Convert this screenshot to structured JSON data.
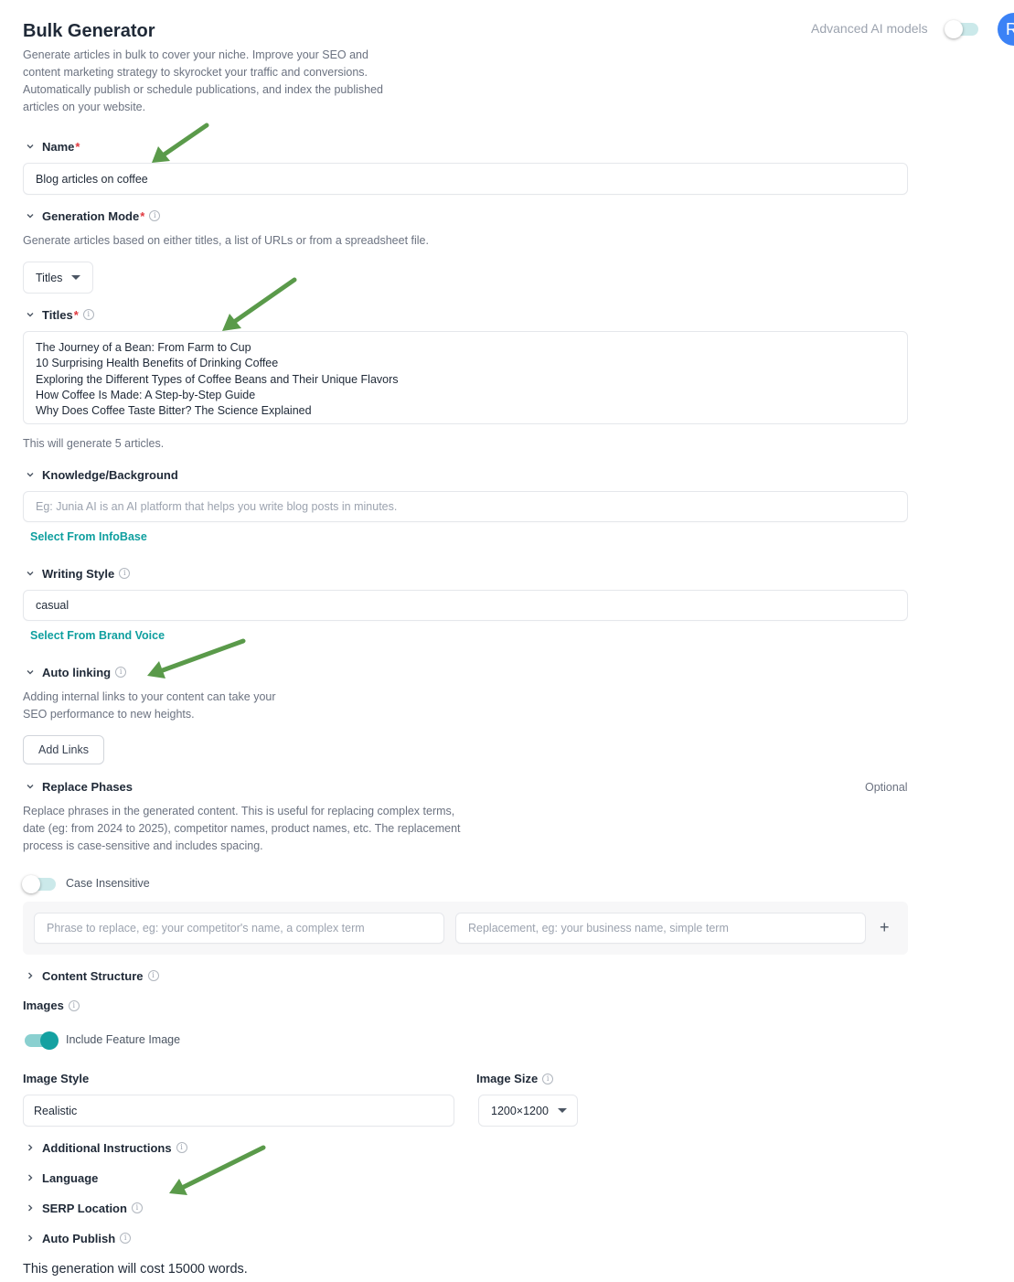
{
  "header": {
    "title": "Bulk Generator",
    "description": "Generate articles in bulk to cover your niche. Improve your SEO and content marketing strategy to skyrocket your traffic and conversions. Automatically publish or schedule publications, and index the published articles on your website.",
    "advanced_label": "Advanced AI models",
    "advanced_enabled": false,
    "avatar_initial": "R"
  },
  "name": {
    "label": "Name",
    "required": "*",
    "value": "Blog articles on coffee"
  },
  "generation_mode": {
    "label": "Generation Mode",
    "required": "*",
    "description": "Generate articles based on either titles, a list of URLs or from a spreadsheet file.",
    "selected": "Titles"
  },
  "titles": {
    "label": "Titles",
    "required": "*",
    "lines": [
      "The Journey of a Bean: From Farm to Cup",
      "10 Surprising Health Benefits of Drinking Coffee",
      "Exploring the Different Types of Coffee Beans and Their Unique Flavors",
      "How Coffee Is Made: A Step-by-Step Guide",
      "Why Does Coffee Taste Bitter? The Science Explained"
    ],
    "count_note": "This will generate 5 articles."
  },
  "knowledge": {
    "label": "Knowledge/Background",
    "placeholder": "Eg: Junia AI is an AI platform that helps you write blog posts in minutes.",
    "link": "Select From InfoBase"
  },
  "writing_style": {
    "label": "Writing Style",
    "value": "casual",
    "link": "Select From Brand Voice"
  },
  "auto_linking": {
    "label": "Auto linking",
    "description": "Adding internal links to your content can take your SEO performance to new heights.",
    "button": "Add Links"
  },
  "replace_phases": {
    "label": "Replace Phases",
    "optional": "Optional",
    "description": "Replace phrases in the generated content. This is useful for replacing complex terms, date (eg: from 2024 to 2025), competitor names, product names, etc. The replacement process is case-sensitive and includes spacing.",
    "case_label": "Case Insensitive",
    "case_enabled": false,
    "phrase_placeholder": "Phrase to replace, eg: your competitor's name, a complex term",
    "replacement_placeholder": "Replacement, eg: your business name, simple term",
    "add_symbol": "+"
  },
  "content_structure": {
    "label": "Content Structure"
  },
  "images": {
    "label": "Images",
    "feature_label": "Include Feature Image",
    "feature_enabled": true,
    "style_label": "Image Style",
    "style_value": "Realistic",
    "size_label": "Image Size",
    "size_value": "1200×1200"
  },
  "collapsed_sections": {
    "additional_instructions": "Additional Instructions",
    "language": "Language",
    "serp_location": "SERP Location",
    "auto_publish": "Auto Publish"
  },
  "cost_note": "This generation will cost 15000 words.",
  "colors": {
    "accent": "#0f9f9f",
    "required": "#e0383e",
    "annotation_arrow": "#5a9a4a"
  },
  "icons": [
    "chevron-down-icon",
    "chevron-right-icon",
    "info-icon",
    "caret-down-icon",
    "plus-icon",
    "annotation-arrow"
  ]
}
